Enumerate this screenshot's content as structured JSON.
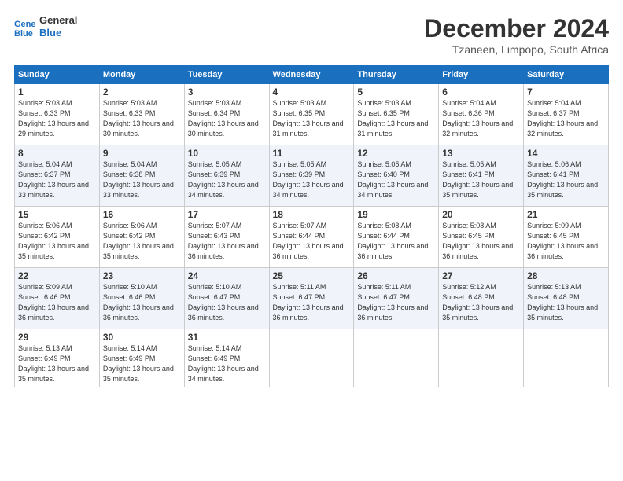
{
  "logo": {
    "general": "General",
    "blue": "Blue"
  },
  "header": {
    "title": "December 2024",
    "subtitle": "Tzaneen, Limpopo, South Africa"
  },
  "days_of_week": [
    "Sunday",
    "Monday",
    "Tuesday",
    "Wednesday",
    "Thursday",
    "Friday",
    "Saturday"
  ],
  "weeks": [
    [
      {
        "day": 1,
        "sunrise": "5:03 AM",
        "sunset": "6:33 PM",
        "daylight": "13 hours and 29 minutes."
      },
      {
        "day": 2,
        "sunrise": "5:03 AM",
        "sunset": "6:33 PM",
        "daylight": "13 hours and 30 minutes."
      },
      {
        "day": 3,
        "sunrise": "5:03 AM",
        "sunset": "6:34 PM",
        "daylight": "13 hours and 30 minutes."
      },
      {
        "day": 4,
        "sunrise": "5:03 AM",
        "sunset": "6:35 PM",
        "daylight": "13 hours and 31 minutes."
      },
      {
        "day": 5,
        "sunrise": "5:03 AM",
        "sunset": "6:35 PM",
        "daylight": "13 hours and 31 minutes."
      },
      {
        "day": 6,
        "sunrise": "5:04 AM",
        "sunset": "6:36 PM",
        "daylight": "13 hours and 32 minutes."
      },
      {
        "day": 7,
        "sunrise": "5:04 AM",
        "sunset": "6:37 PM",
        "daylight": "13 hours and 32 minutes."
      }
    ],
    [
      {
        "day": 8,
        "sunrise": "5:04 AM",
        "sunset": "6:37 PM",
        "daylight": "13 hours and 33 minutes."
      },
      {
        "day": 9,
        "sunrise": "5:04 AM",
        "sunset": "6:38 PM",
        "daylight": "13 hours and 33 minutes."
      },
      {
        "day": 10,
        "sunrise": "5:05 AM",
        "sunset": "6:39 PM",
        "daylight": "13 hours and 34 minutes."
      },
      {
        "day": 11,
        "sunrise": "5:05 AM",
        "sunset": "6:39 PM",
        "daylight": "13 hours and 34 minutes."
      },
      {
        "day": 12,
        "sunrise": "5:05 AM",
        "sunset": "6:40 PM",
        "daylight": "13 hours and 34 minutes."
      },
      {
        "day": 13,
        "sunrise": "5:05 AM",
        "sunset": "6:41 PM",
        "daylight": "13 hours and 35 minutes."
      },
      {
        "day": 14,
        "sunrise": "5:06 AM",
        "sunset": "6:41 PM",
        "daylight": "13 hours and 35 minutes."
      }
    ],
    [
      {
        "day": 15,
        "sunrise": "5:06 AM",
        "sunset": "6:42 PM",
        "daylight": "13 hours and 35 minutes."
      },
      {
        "day": 16,
        "sunrise": "5:06 AM",
        "sunset": "6:42 PM",
        "daylight": "13 hours and 35 minutes."
      },
      {
        "day": 17,
        "sunrise": "5:07 AM",
        "sunset": "6:43 PM",
        "daylight": "13 hours and 36 minutes."
      },
      {
        "day": 18,
        "sunrise": "5:07 AM",
        "sunset": "6:44 PM",
        "daylight": "13 hours and 36 minutes."
      },
      {
        "day": 19,
        "sunrise": "5:08 AM",
        "sunset": "6:44 PM",
        "daylight": "13 hours and 36 minutes."
      },
      {
        "day": 20,
        "sunrise": "5:08 AM",
        "sunset": "6:45 PM",
        "daylight": "13 hours and 36 minutes."
      },
      {
        "day": 21,
        "sunrise": "5:09 AM",
        "sunset": "6:45 PM",
        "daylight": "13 hours and 36 minutes."
      }
    ],
    [
      {
        "day": 22,
        "sunrise": "5:09 AM",
        "sunset": "6:46 PM",
        "daylight": "13 hours and 36 minutes."
      },
      {
        "day": 23,
        "sunrise": "5:10 AM",
        "sunset": "6:46 PM",
        "daylight": "13 hours and 36 minutes."
      },
      {
        "day": 24,
        "sunrise": "5:10 AM",
        "sunset": "6:47 PM",
        "daylight": "13 hours and 36 minutes."
      },
      {
        "day": 25,
        "sunrise": "5:11 AM",
        "sunset": "6:47 PM",
        "daylight": "13 hours and 36 minutes."
      },
      {
        "day": 26,
        "sunrise": "5:11 AM",
        "sunset": "6:47 PM",
        "daylight": "13 hours and 36 minutes."
      },
      {
        "day": 27,
        "sunrise": "5:12 AM",
        "sunset": "6:48 PM",
        "daylight": "13 hours and 35 minutes."
      },
      {
        "day": 28,
        "sunrise": "5:13 AM",
        "sunset": "6:48 PM",
        "daylight": "13 hours and 35 minutes."
      }
    ],
    [
      {
        "day": 29,
        "sunrise": "5:13 AM",
        "sunset": "6:49 PM",
        "daylight": "13 hours and 35 minutes."
      },
      {
        "day": 30,
        "sunrise": "5:14 AM",
        "sunset": "6:49 PM",
        "daylight": "13 hours and 35 minutes."
      },
      {
        "day": 31,
        "sunrise": "5:14 AM",
        "sunset": "6:49 PM",
        "daylight": "13 hours and 34 minutes."
      },
      null,
      null,
      null,
      null
    ]
  ]
}
